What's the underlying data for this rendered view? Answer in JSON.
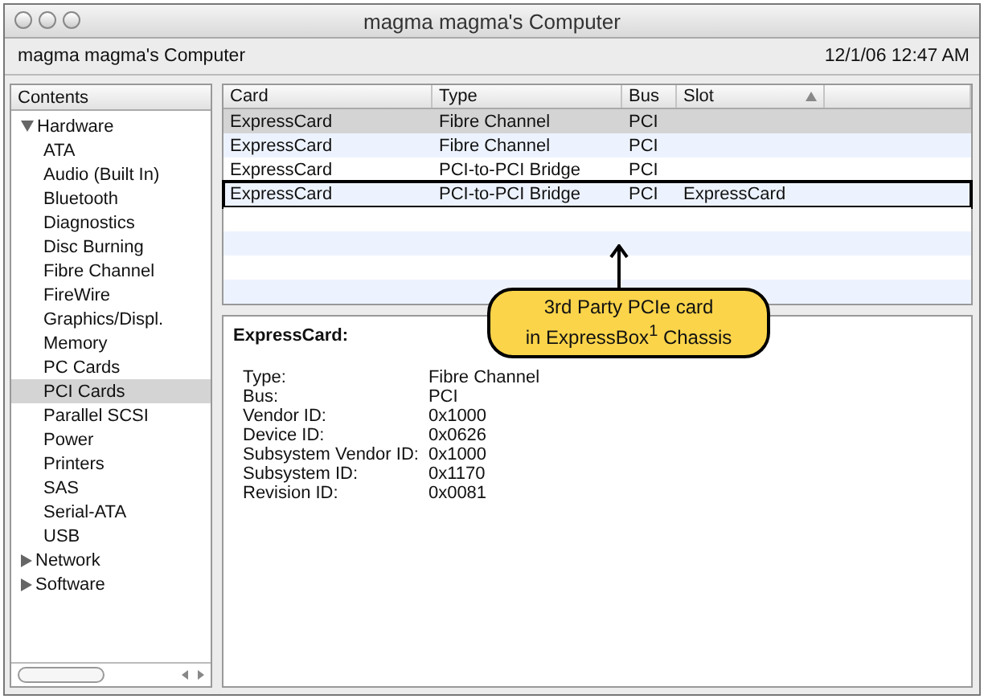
{
  "window": {
    "title": "magma magma's Computer"
  },
  "header": {
    "computer": "magma magma's Computer",
    "date": "12/1/06 12:47 AM"
  },
  "sidebar": {
    "title": "Contents",
    "items": [
      {
        "label": "Hardware",
        "expanded": true,
        "selected": false,
        "children": [
          {
            "label": "ATA",
            "selected": false
          },
          {
            "label": "Audio (Built In)",
            "selected": false
          },
          {
            "label": "Bluetooth",
            "selected": false
          },
          {
            "label": "Diagnostics",
            "selected": false
          },
          {
            "label": "Disc Burning",
            "selected": false
          },
          {
            "label": "Fibre Channel",
            "selected": false
          },
          {
            "label": "FireWire",
            "selected": false
          },
          {
            "label": "Graphics/Displ.",
            "selected": false
          },
          {
            "label": "Memory",
            "selected": false
          },
          {
            "label": "PC Cards",
            "selected": false
          },
          {
            "label": "PCI Cards",
            "selected": true
          },
          {
            "label": "Parallel SCSI",
            "selected": false
          },
          {
            "label": "Power",
            "selected": false
          },
          {
            "label": "Printers",
            "selected": false
          },
          {
            "label": "SAS",
            "selected": false
          },
          {
            "label": "Serial-ATA",
            "selected": false
          },
          {
            "label": "USB",
            "selected": false
          }
        ]
      },
      {
        "label": "Network",
        "expanded": false,
        "selected": false
      },
      {
        "label": "Software",
        "expanded": false,
        "selected": false
      }
    ]
  },
  "table": {
    "columns": [
      {
        "label": "Card",
        "sorted": false
      },
      {
        "label": "Type",
        "sorted": false
      },
      {
        "label": "Bus",
        "sorted": false
      },
      {
        "label": "Slot",
        "sorted": true
      }
    ],
    "rows": [
      {
        "cells": [
          "ExpressCard",
          "Fibre Channel",
          "PCI",
          ""
        ],
        "selected": true,
        "outlined": false
      },
      {
        "cells": [
          "ExpressCard",
          "Fibre Channel",
          "PCI",
          ""
        ],
        "selected": false,
        "outlined": false
      },
      {
        "cells": [
          "ExpressCard",
          "PCI-to-PCI Bridge",
          "PCI",
          ""
        ],
        "selected": false,
        "outlined": false
      },
      {
        "cells": [
          "ExpressCard",
          "PCI-to-PCI Bridge",
          "PCI",
          "ExpressCard"
        ],
        "selected": false,
        "outlined": true
      }
    ]
  },
  "detail": {
    "title": "ExpressCard:",
    "fields": [
      {
        "label": "Type:",
        "value": "Fibre Channel"
      },
      {
        "label": "Bus:",
        "value": "PCI"
      },
      {
        "label": "Vendor ID:",
        "value": "0x1000"
      },
      {
        "label": "Device ID:",
        "value": "0x0626"
      },
      {
        "label": "Subsystem Vendor ID:",
        "value": "0x1000"
      },
      {
        "label": "Subsystem ID:",
        "value": "0x1170"
      },
      {
        "label": "Revision ID:",
        "value": "0x0081"
      }
    ]
  },
  "callout": {
    "lines": [
      "3rd Party PCIe card",
      "in ExpressBox$^{1}$ Chassis"
    ]
  }
}
